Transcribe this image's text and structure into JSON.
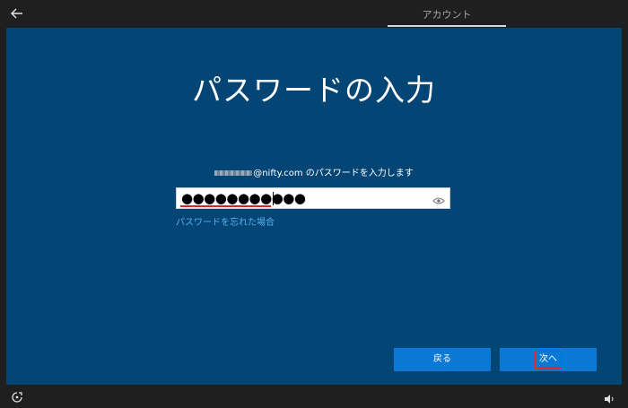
{
  "header": {
    "tab_label": "アカウント"
  },
  "main": {
    "title": "パスワードの入力",
    "subtitle_suffix": "@nifty.com のパスワードを入力します",
    "password_mask": "●●●●●●●●●●●",
    "forgot_link": "パスワードを忘れた場合"
  },
  "buttons": {
    "back_label": "戻る",
    "next_label": "次へ"
  },
  "icons": {
    "back": "back-arrow-icon",
    "reveal": "eye-icon",
    "accessibility": "ease-of-access-icon",
    "volume": "volume-icon"
  },
  "colors": {
    "background": "#034574",
    "accent": "#0a78d4",
    "link": "#5ab0f0",
    "highlight": "#e0242a"
  }
}
